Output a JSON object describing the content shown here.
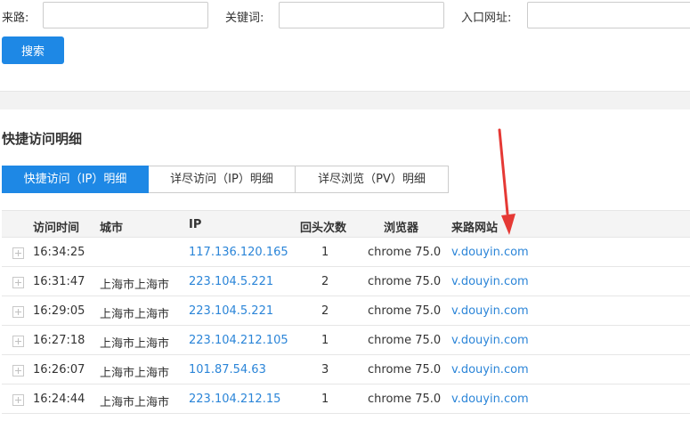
{
  "filters": {
    "source_label": "来路:",
    "source_value": "",
    "keyword_label": "关键词:",
    "keyword_value": "",
    "entry_url_label": "入口网址:",
    "entry_url_value": ""
  },
  "search_button": "搜索",
  "section_title": "快捷访问明细",
  "tabs": [
    {
      "label": "快捷访问（IP）明细",
      "active": true
    },
    {
      "label": "详尽访问（IP）明细",
      "active": false
    },
    {
      "label": "详尽浏览（PV）明细",
      "active": false
    }
  ],
  "table": {
    "headers": [
      "访问时间",
      "城市",
      "IP",
      "回头次数",
      "浏览器",
      "来路网站"
    ],
    "rows": [
      {
        "time": "16:34:25",
        "city": "",
        "ip": "117.136.120.165",
        "visits": "1",
        "browser": "chrome 75.0",
        "referrer": "v.douyin.com"
      },
      {
        "time": "16:31:47",
        "city": "上海市上海市",
        "ip": "223.104.5.221",
        "visits": "2",
        "browser": "chrome 75.0",
        "referrer": "v.douyin.com"
      },
      {
        "time": "16:29:05",
        "city": "上海市上海市",
        "ip": "223.104.5.221",
        "visits": "2",
        "browser": "chrome 75.0",
        "referrer": "v.douyin.com"
      },
      {
        "time": "16:27:18",
        "city": "上海市上海市",
        "ip": "223.104.212.105",
        "visits": "1",
        "browser": "chrome 75.0",
        "referrer": "v.douyin.com"
      },
      {
        "time": "16:26:07",
        "city": "上海市上海市",
        "ip": "101.87.54.63",
        "visits": "3",
        "browser": "chrome 75.0",
        "referrer": "v.douyin.com"
      },
      {
        "time": "16:24:44",
        "city": "上海市上海市",
        "ip": "223.104.212.15",
        "visits": "1",
        "browser": "chrome 75.0",
        "referrer": "v.douyin.com"
      }
    ]
  },
  "colors": {
    "accent": "#1e88e5",
    "link": "#2b85d8",
    "annotation_arrow": "#e53935"
  }
}
